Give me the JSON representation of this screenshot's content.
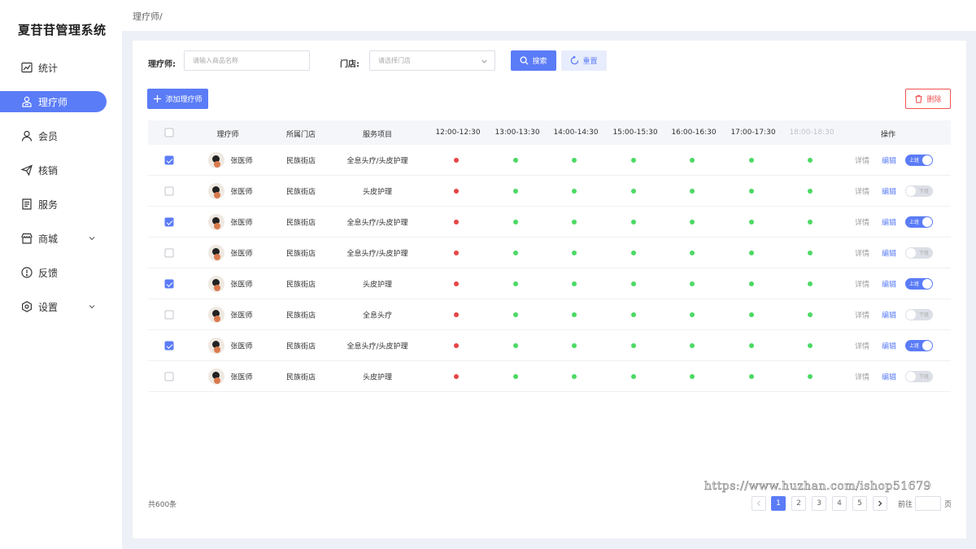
{
  "app": {
    "title": "夏苷苷管理系统"
  },
  "sidebar": {
    "items": [
      {
        "label": "统计",
        "icon": "chart-icon",
        "active": false
      },
      {
        "label": "理疗师",
        "icon": "therapist-icon",
        "active": true
      },
      {
        "label": "会员",
        "icon": "user-icon",
        "active": false
      },
      {
        "label": "核销",
        "icon": "send-icon",
        "active": false
      },
      {
        "label": "服务",
        "icon": "document-icon",
        "active": false
      },
      {
        "label": "商城",
        "icon": "store-icon",
        "active": false,
        "expandable": true
      },
      {
        "label": "反馈",
        "icon": "alert-icon",
        "active": false
      },
      {
        "label": "设置",
        "icon": "gear-icon",
        "active": false,
        "expandable": true
      }
    ]
  },
  "breadcrumb": "理疗师/",
  "filters": {
    "therapist_label": "理疗师:",
    "therapist_placeholder": "请输入商品名称",
    "store_label": "门店:",
    "store_placeholder": "请选择门店",
    "search_label": "搜索",
    "reset_label": "重置"
  },
  "toolbar": {
    "add_label": "添加理疗师",
    "delete_label": "删除"
  },
  "table": {
    "headers": {
      "therapist": "理疗师",
      "store": "所属门店",
      "service": "服务项目",
      "slots": [
        "12:00-12:30",
        "13:00-13:30",
        "14:00-14:30",
        "15:00-15:30",
        "16:00-16:30",
        "17:00-17:30",
        "18:00-18:30"
      ],
      "actions": "操作"
    },
    "detail_label": "详情",
    "edit_label": "编辑",
    "on_label": "上班",
    "off_label": "下班",
    "rows": [
      {
        "checked": true,
        "name": "张医师",
        "store": "民族街店",
        "service": "全息头疗/头皮护理",
        "on_duty": true
      },
      {
        "checked": false,
        "name": "张医师",
        "store": "民族街店",
        "service": "头皮护理",
        "on_duty": false
      },
      {
        "checked": true,
        "name": "张医师",
        "store": "民族街店",
        "service": "全息头疗/头皮护理",
        "on_duty": true
      },
      {
        "checked": false,
        "name": "张医师",
        "store": "民族街店",
        "service": "全息头疗/头皮护理",
        "on_duty": false
      },
      {
        "checked": true,
        "name": "张医师",
        "store": "民族街店",
        "service": "头皮护理",
        "on_duty": true
      },
      {
        "checked": false,
        "name": "张医师",
        "store": "民族街店",
        "service": "全息头疗",
        "on_duty": false
      },
      {
        "checked": true,
        "name": "张医师",
        "store": "民族街店",
        "service": "全息头疗/头皮护理",
        "on_duty": true
      },
      {
        "checked": false,
        "name": "张医师",
        "store": "民族街店",
        "service": "头皮护理",
        "on_duty": false
      }
    ],
    "slot_status": [
      "busy",
      "free",
      "free",
      "free",
      "free",
      "free",
      "free"
    ]
  },
  "footer": {
    "total": "共600条",
    "pages": [
      "1",
      "2",
      "3",
      "4",
      "5"
    ],
    "current_page": "1",
    "goto_label": "前往",
    "page_unit": "页"
  },
  "watermark": "https://www.huzhan.com/ishop51679",
  "colors": {
    "accent": "#5b7cf7",
    "busy": "#e84545",
    "free": "#4cd964",
    "danger": "#f25353"
  }
}
